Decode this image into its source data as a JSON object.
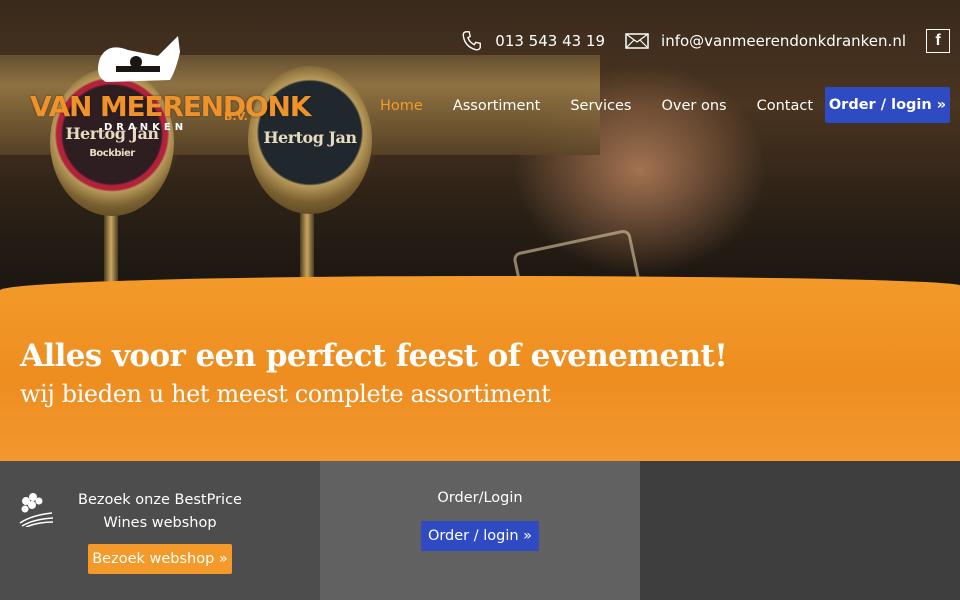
{
  "header": {
    "phone": "013 543 43 19",
    "email": "info@vanmeerendonkdranken.nl",
    "facebook_label": "f"
  },
  "logo": {
    "name": "VAN MEERENDONK",
    "suffix": "B.V.",
    "subtitle": "DRANKEN"
  },
  "hero": {
    "tap_left_label": "Hertog Jan",
    "tap_left_sub": "Bockbier",
    "tap_right_label": "Hertog Jan"
  },
  "nav": {
    "items": [
      {
        "label": "Home",
        "active": true
      },
      {
        "label": "Assortiment"
      },
      {
        "label": "Services"
      },
      {
        "label": "Over ons"
      },
      {
        "label": "Contact"
      }
    ],
    "order_button": "Order / login »"
  },
  "banner": {
    "title": "Alles voor een perfect feest of evenement!",
    "subtitle": "wij bieden u het meest complete assortiment"
  },
  "panels": {
    "webshop": {
      "text": "Bezoek onze BestPrice Wines webshop",
      "button": "Bezoek webshop »"
    },
    "order": {
      "text": "Order/Login",
      "button": "Order / login »"
    }
  },
  "colors": {
    "accent_orange": "#f39a2a",
    "button_blue": "#2f4bc4"
  }
}
